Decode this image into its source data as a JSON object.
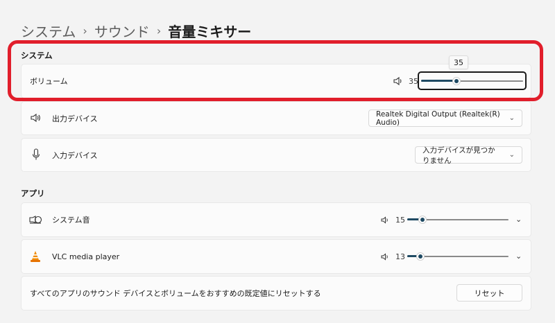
{
  "breadcrumb": [
    "システム",
    "サウンド",
    "音量ミキサー"
  ],
  "system_section": {
    "title": "システム",
    "volume": {
      "label": "ボリューム",
      "value": "35",
      "tooltip": "35",
      "level": 0.35
    },
    "output_device": {
      "label": "出力デバイス",
      "selected": "Realtek Digital Output (Realtek(R) Audio)"
    },
    "input_device": {
      "label": "入力デバイス",
      "selected": "入力デバイスが見つかりません"
    }
  },
  "apps_section": {
    "title": "アプリ",
    "apps": [
      {
        "name": "システム音",
        "value": "15",
        "level": 0.15,
        "icon": "system-sounds-icon"
      },
      {
        "name": "VLC media player",
        "value": "13",
        "level": 0.13,
        "icon": "vlc-icon"
      }
    ]
  },
  "reset_row": {
    "text": "すべてのアプリのサウンド デバイスとボリュームをおすすめの既定値にリセットする",
    "button": "リセット"
  },
  "colors": {
    "accent": "#1f4a63",
    "highlight": "#e11e2b",
    "background": "#f3f3f3"
  }
}
